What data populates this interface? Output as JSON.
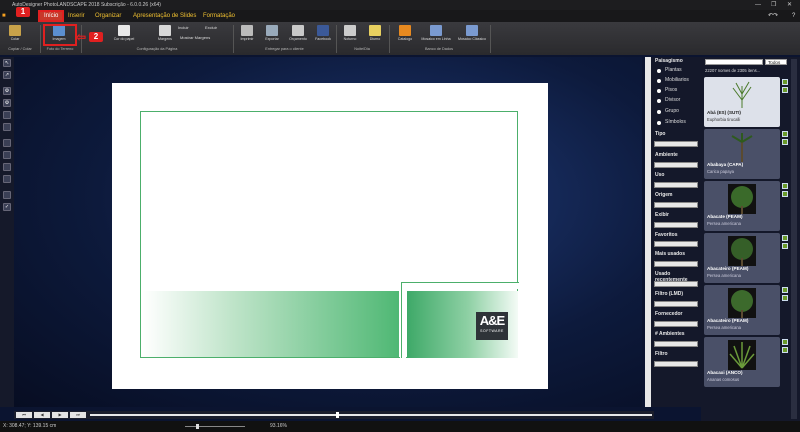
{
  "window": {
    "title": "AutoDesigner PhotoLANDSCAPE 2018 Subscrição - 6.0.0.26 (x64)"
  },
  "menu": {
    "items": [
      "Início",
      "Inserir",
      "Organizar",
      "Apresentação de Slides",
      "Formatação"
    ],
    "active": "Início"
  },
  "ribbon": {
    "buttons": [
      "Colar",
      "Imagem",
      "Cor do papel",
      "Margens",
      "Incluir",
      "Excluir",
      "Mostrar Margens",
      "Imprimir",
      "Exportar",
      "Orçamento",
      "Facebook",
      "Noturno",
      "Diurno",
      "Catalogo",
      "Mosaico em Linha",
      "Mosaico Clássico"
    ],
    "groups": [
      "Copiar / Colar",
      "Foto do Terreno",
      "Configuração da Página",
      "Entregar para o cliente",
      "Noite/Dia",
      "Banco de Dados"
    ]
  },
  "annotations": {
    "badge1": "1",
    "badge2": "2"
  },
  "logo": {
    "text": "A&E",
    "sub": "SOFTWARE"
  },
  "status": {
    "coords": "X: 308.47; Y: 139.15 cm",
    "zoom": "93.16%"
  },
  "filters": {
    "title": "Paisagismo",
    "options": [
      "Plantas",
      "Mobiliarios",
      "Pisos",
      "Divisor",
      "Grupo",
      "Símbolos"
    ],
    "labels": [
      "Tipo",
      "Ambiente",
      "Uso",
      "Origem",
      "Exibir",
      "Favoritos",
      "Mais usados",
      "Usado recentemente",
      "Filtro (LMD)",
      "Fornecedor",
      "# Ambientes",
      "Filtro"
    ]
  },
  "catalog": {
    "scope": "Todos",
    "count": "22207 nomes de 2305 itens...",
    "items": [
      {
        "name": "Abá (ES) (SUTI)",
        "sci": "Euphorbia tirucalli"
      },
      {
        "name": "Ababaya (CAPA)",
        "sci": "Carica papaya"
      },
      {
        "name": "Abacate (PEAM)",
        "sci": "Persea americana"
      },
      {
        "name": "Abacateiro (PEAM)",
        "sci": "Persea americana"
      },
      {
        "name": "Abacateiro (PEAM)",
        "sci": "Persea americana"
      },
      {
        "name": "Abacaxi (ANCO)",
        "sci": "Ananas comosus"
      }
    ]
  }
}
